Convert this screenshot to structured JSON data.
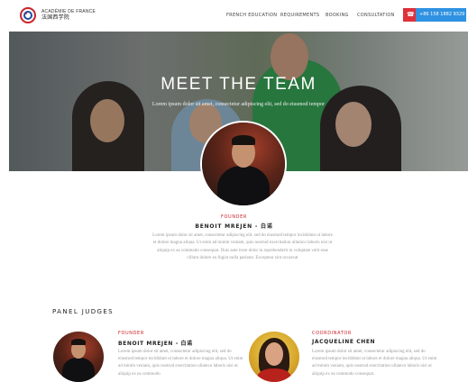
{
  "header": {
    "brand_line1": "ACADÉMIE DE FRANCE",
    "brand_line2": "法国西学院",
    "nav": [
      "FRENCH EDUCATION",
      "REQUIREMENTS",
      "BOOKING",
      "CONSULTATION"
    ],
    "phone": "+86 158 1882 9329",
    "phone_icon": "phone-icon",
    "colors": {
      "accent_red": "#c9242b",
      "accent_blue": "#2f92e2"
    }
  },
  "hero": {
    "title": "MEET THE TEAM",
    "subtitle": "Lorem ipsum dolor sit amet, consectetur adipiscing elit, sed do eiusmod tempor"
  },
  "founder": {
    "role": "FOUNDER",
    "name": "BENOIT MREJEN - 白诺",
    "bio": "Lorem ipsum dolor sit amet, consectetur adipiscing elit, sed do eiusmod tempor incididunt ut labore et dolore magna aliqua. Ut enim ad minim veniam, quis nostrud exercitation ullamco laboris nisi ut aliquip ex ea commodo consequat. Duis aute irure dolor in reprehenderit in voluptate velit esse cillum dolore eu fugiat nulla pariatur. Excepteur sint occaecat"
  },
  "panel": {
    "title": "PANEL JUDGES",
    "judges": [
      {
        "role": "FOUNDER",
        "name": "BENOIT MREJEN - 白诺",
        "bio": "Lorem ipsum dolor sit amet, consectetur adipiscing elit, sed do eiusmod tempor incididunt ut labore et dolore magna aliqua. Ut enim ad minim veniam, quis nostrud exercitation ullamco laboris nisi ut aliquip ex ea commodo"
      },
      {
        "role": "COORDINATOR",
        "name": "JACQUELINE CHEN",
        "bio": "Lorem ipsum dolor sit amet, consectetur adipiscing elit, sed do eiusmod tempor incididunt ut labore et dolore magna aliqua. Ut enim ad minim veniam, quis nostrud exercitation ullamco laboris nisi ut aliquip ex ea commodo consequat."
      }
    ]
  }
}
